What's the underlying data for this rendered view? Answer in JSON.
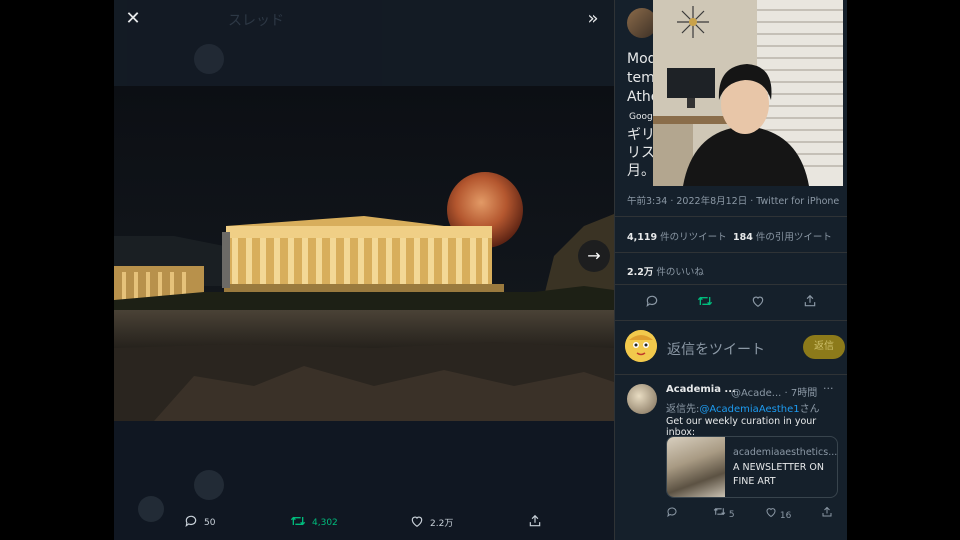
{
  "viewer": {
    "close_icon": "close-icon",
    "expand_icon": "double-chevron-right-icon",
    "next_icon": "arrow-right-icon",
    "background_header_title": "スレッド",
    "actions": {
      "reply_count": "50",
      "retweet_count": "4,302",
      "like_count": "2.2万"
    }
  },
  "tweet": {
    "text_en": "Mod\ntem\nAthe",
    "translate_label": "Goog",
    "text_ja": "ギリ\nリス\n月。",
    "meta": "午前3:34 · 2022年8月12日 · Twitter for iPhone",
    "retweets_num": "4,119",
    "retweets_label": "件のリツイート",
    "quotes_num": "184",
    "quotes_label": "件の引用ツイート",
    "likes_num": "2.2万",
    "likes_label": "件のいいね",
    "reply_placeholder": "返信をツイート",
    "reply_button": "返信"
  },
  "reply": {
    "name": "Academia ...",
    "handle": "@Acade...",
    "time": "· 7時間",
    "more": "···",
    "reply_to_prefix": "返信先:",
    "reply_to_user": "@AcademiaAesthe1",
    "reply_to_suffix": "さん",
    "text": "Get our weekly curation in your inbox:",
    "card_domain": "academiaaesthetics...",
    "card_title": "A NEWSLETTER ON FINE ART",
    "retweets": "5",
    "likes": "16"
  },
  "colors": {
    "panel_bg": "#15202b",
    "accent_green": "#00ba7c",
    "link_blue": "#1d9bf0"
  }
}
